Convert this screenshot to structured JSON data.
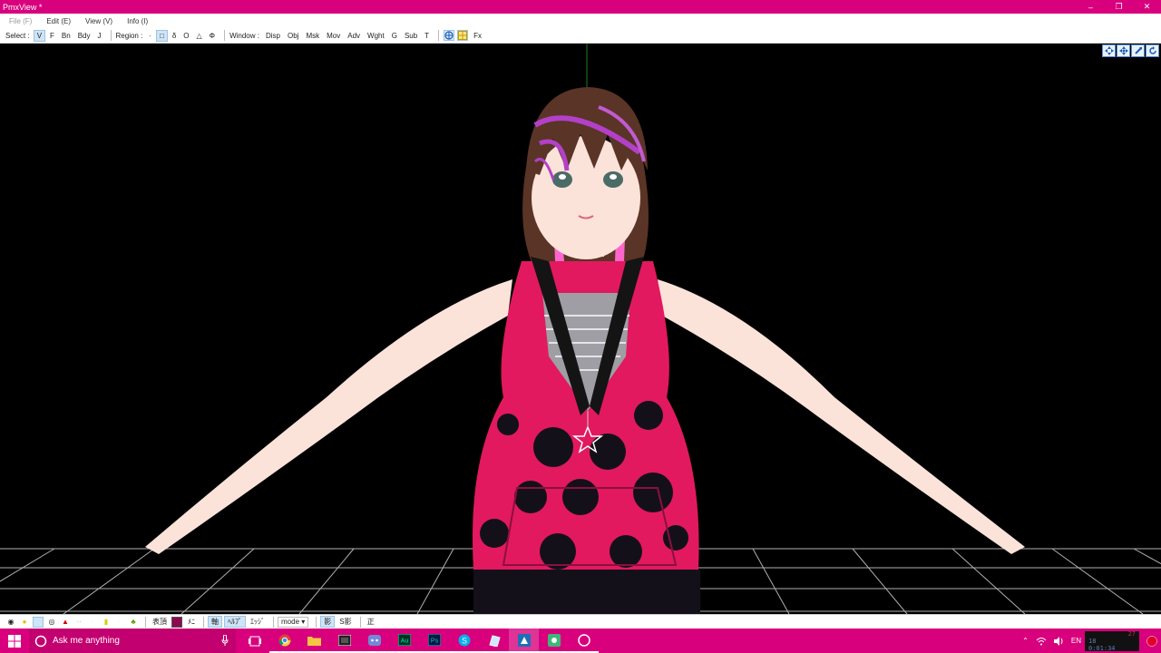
{
  "window": {
    "title": "PmxView *",
    "minimize": "–",
    "restore": "❐",
    "close": "✕"
  },
  "menu": {
    "items": [
      {
        "label": "File (F)",
        "disabled": true
      },
      {
        "label": "Edit (E)"
      },
      {
        "label": "View (V)"
      },
      {
        "label": "Info (I)"
      }
    ]
  },
  "toolbar": {
    "select_label": "Select :",
    "select_items": [
      "V",
      "F",
      "Bn",
      "Bdy",
      "J"
    ],
    "region_label": "Region :",
    "region_items": [
      "·",
      "□",
      "δ",
      "O",
      "△",
      "Φ"
    ],
    "window_label": "Window :",
    "window_items": [
      "Disp",
      "Obj",
      "Msk",
      "Mov",
      "Adv",
      "Wght",
      "G",
      "Sub",
      "T"
    ],
    "fx_label": "Fx"
  },
  "bottombar": {
    "items_a": [
      "表頂",
      "ﾒﾆ"
    ],
    "items_b": [
      "軸",
      "ﾍﾙﾌﾟ",
      "ｴｯｼﾞ"
    ],
    "mode_label": "mode",
    "items_c": [
      "影",
      "S影"
    ],
    "item_d": "正"
  },
  "taskbar": {
    "search_placeholder": "Ask me anything",
    "apps": [
      "Chrome",
      "File Explorer",
      "Media",
      "Discord",
      "Au",
      "Ps",
      "Skype",
      "Notes",
      "PmxView",
      "Tool",
      "Record"
    ],
    "tray_lang": "EN",
    "clock_top": "27",
    "clock_mid": "18",
    "clock_bot": "0:01:34"
  },
  "colors": {
    "accent": "#d8007d",
    "search_bg": "#c3006f",
    "viewport_bg": "#000000",
    "grid": "#b0b0b0",
    "skin": "#fbe3da",
    "dress": "#e2195f",
    "dots": "#14101a",
    "hair": "#5a3426",
    "hair_streak": "#b340c8"
  }
}
